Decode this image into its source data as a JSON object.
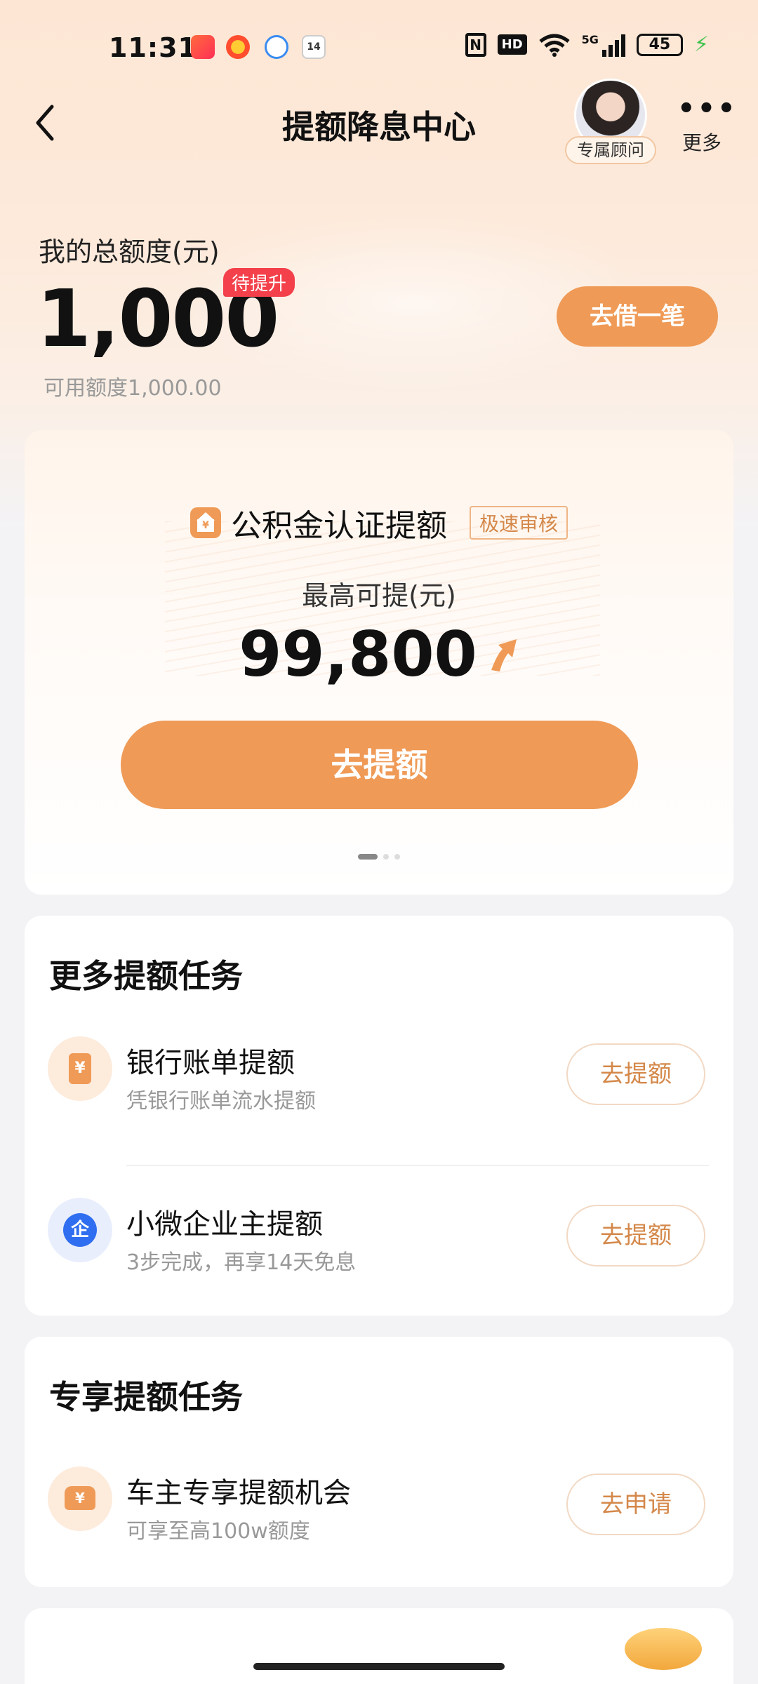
{
  "status_bar": {
    "time": "11:31",
    "app_icon_date": "14",
    "network": "5G",
    "battery": "45"
  },
  "nav": {
    "title": "提额降息中心",
    "advisor_label": "专属顾问",
    "more_label": "更多"
  },
  "quota": {
    "label": "我的总额度(元)",
    "amount": "1,000",
    "badge": "待提升",
    "available": "可用额度1,000.00",
    "borrow_button": "去借一笔"
  },
  "promo": {
    "title": "公积金认证提额",
    "badge": "极速审核",
    "max_label": "最高可提(元)",
    "max_amount": "99,800",
    "button": "去提额",
    "page_count": 3,
    "active_page": 1
  },
  "more_tasks": {
    "title": "更多提额任务",
    "items": [
      {
        "name": "银行账单提额",
        "desc": "凭银行账单流水提额",
        "button": "去提额",
        "icon": "bank-bill-icon"
      },
      {
        "name": "小微企业主提额",
        "desc": "3步完成，再享14天免息",
        "button": "去提额",
        "icon": "enterprise-icon"
      }
    ]
  },
  "exclusive_tasks": {
    "title": "专享提额任务",
    "items": [
      {
        "name": "车主专享提额机会",
        "desc": "可享至高100w额度",
        "button": "去申请",
        "icon": "car-owner-icon"
      }
    ]
  },
  "colors": {
    "accent": "#ef9a56",
    "badge_red": "#f3404b",
    "button_text_orange": "#d4884a",
    "enterprise_blue": "#2f6ef0"
  }
}
